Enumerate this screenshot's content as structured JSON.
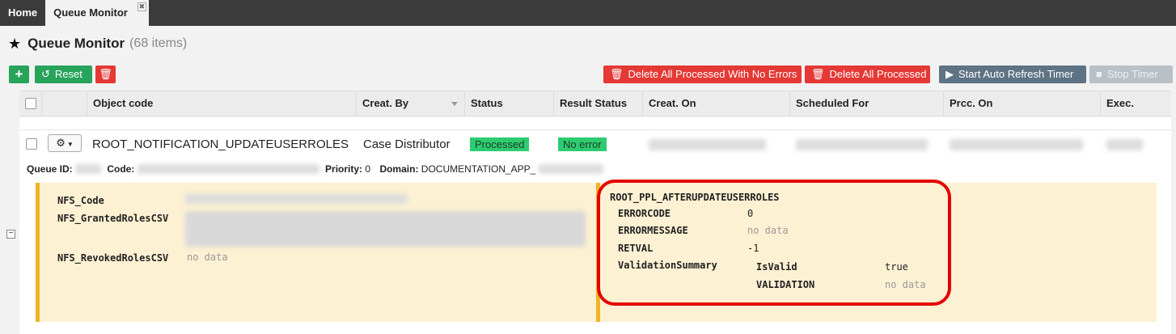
{
  "tabs": [
    {
      "label": "Home"
    },
    {
      "label": "Queue Monitor",
      "closable": true,
      "close_glyph": "✖"
    }
  ],
  "header": {
    "title": "Queue Monitor",
    "count": "(68 items)",
    "icon": "star-icon"
  },
  "toolbar": {
    "reset_label": "Reset",
    "delete_all_no_errors_label": "Delete All Processed With No Errors",
    "delete_all_processed_label": "Delete All Processed",
    "start_timer_label": "Start Auto Refresh Timer",
    "stop_timer_label": "Stop Timer"
  },
  "table": {
    "columns": [
      "Object code",
      "Creat. By",
      "Status",
      "Result Status",
      "Creat. On",
      "Scheduled For",
      "Prcc. On",
      "Exec."
    ],
    "rows": [
      {
        "object_code": "ROOT_NOTIFICATION_UPDATEUSERROLES",
        "created_by": "Case Distributor",
        "status": "Processed",
        "result_status": "No error"
      }
    ]
  },
  "meta": {
    "queue_id_label": "Queue ID:",
    "code_label": "Code:",
    "priority_label": "Priority:",
    "priority_value": "0",
    "domain_label": "Domain:",
    "domain_value": "DOCUMENTATION_APP_"
  },
  "detail": {
    "params": [
      {
        "key": "NFS_Code"
      },
      {
        "key": "NFS_GrantedRolesCSV"
      },
      {
        "key": "NFS_RevokedRolesCSV",
        "value": "no data"
      }
    ],
    "result": {
      "name": "ROOT_PPL_AFTERUPDATEUSERROLES",
      "fields": [
        {
          "key": "ERRORCODE",
          "value": "0"
        },
        {
          "key": "ERRORMESSAGE",
          "value": "no data"
        },
        {
          "key": "RETVAL",
          "value": "-1"
        },
        {
          "key": "ValidationSummary"
        }
      ],
      "validation": [
        {
          "key": "IsValid",
          "value": "true"
        },
        {
          "key": "VALIDATION",
          "value": "no data"
        }
      ]
    }
  },
  "colors": {
    "accent_green": "#27a35a",
    "danger_red": "#e53935",
    "badge_green": "#2ecc71",
    "detail_bg": "#fdf1d3",
    "detail_bar": "#f0b429",
    "highlight": "#e50000"
  }
}
